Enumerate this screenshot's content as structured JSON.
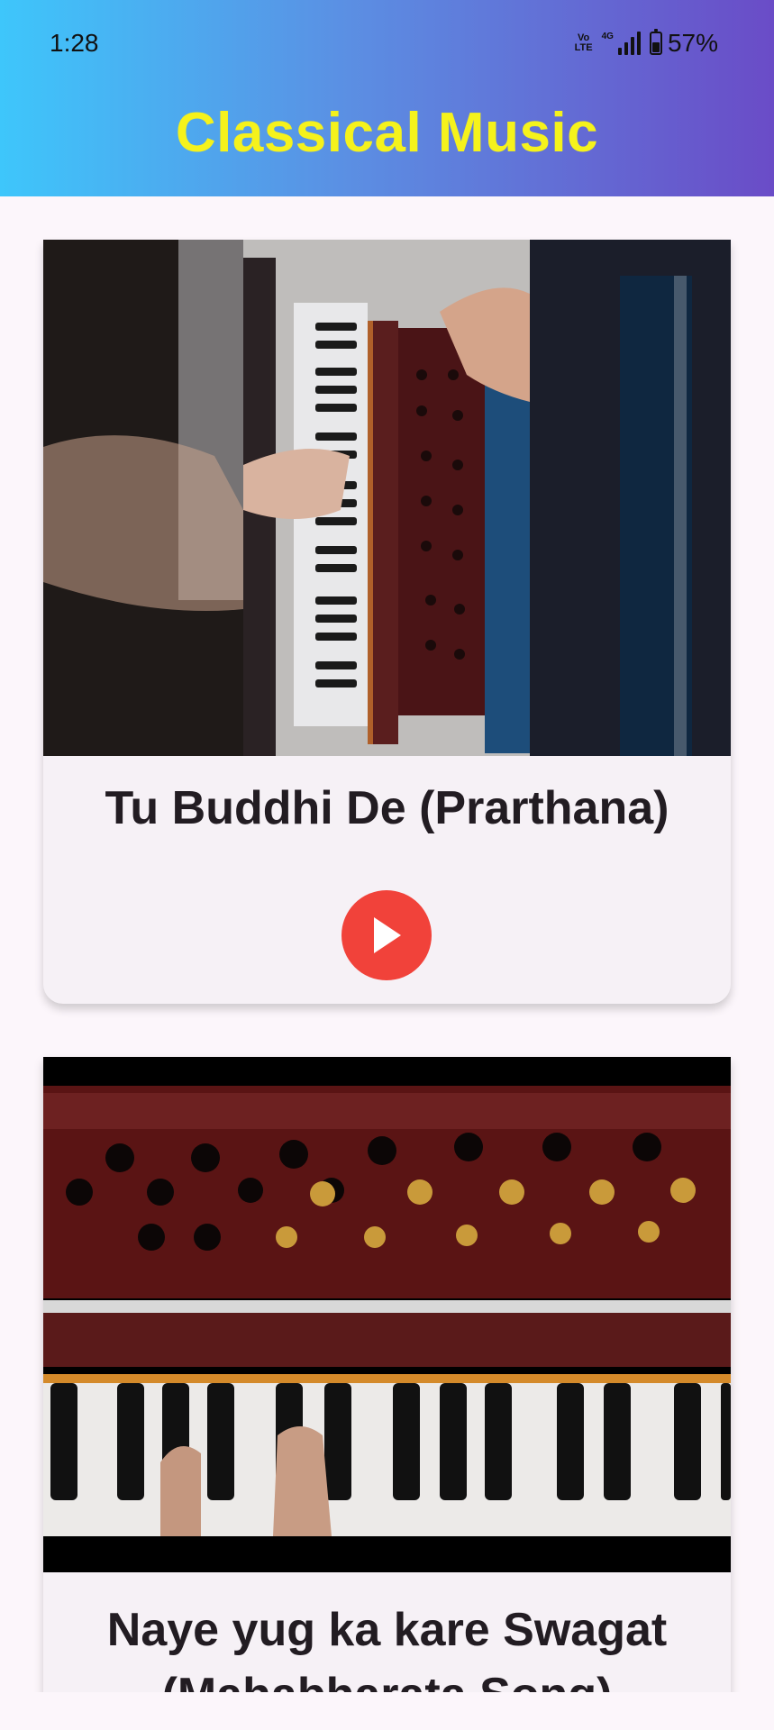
{
  "status_bar": {
    "time": "1:28",
    "volte_top": "Vo",
    "volte_bottom": "LTE",
    "network": "4G",
    "battery_percent": "57%",
    "battery_level": 0.57
  },
  "header": {
    "title": "Classical Music",
    "title_color": "#f5f21c",
    "gradient": [
      "#3ec6fb",
      "#6a4cc7"
    ]
  },
  "cards": [
    {
      "title": "Tu Buddhi De (Prarthana)",
      "thumbnail": "harmonium-video-thumbnail-1",
      "play_icon": "play-icon"
    },
    {
      "title": "Naye yug ka kare Swagat (Mahabharata Song)",
      "thumbnail": "harmonium-video-thumbnail-2"
    }
  ],
  "colors": {
    "background": "#fcf6fb",
    "card": "#f6f1f6",
    "play_button": "#f1423a"
  }
}
